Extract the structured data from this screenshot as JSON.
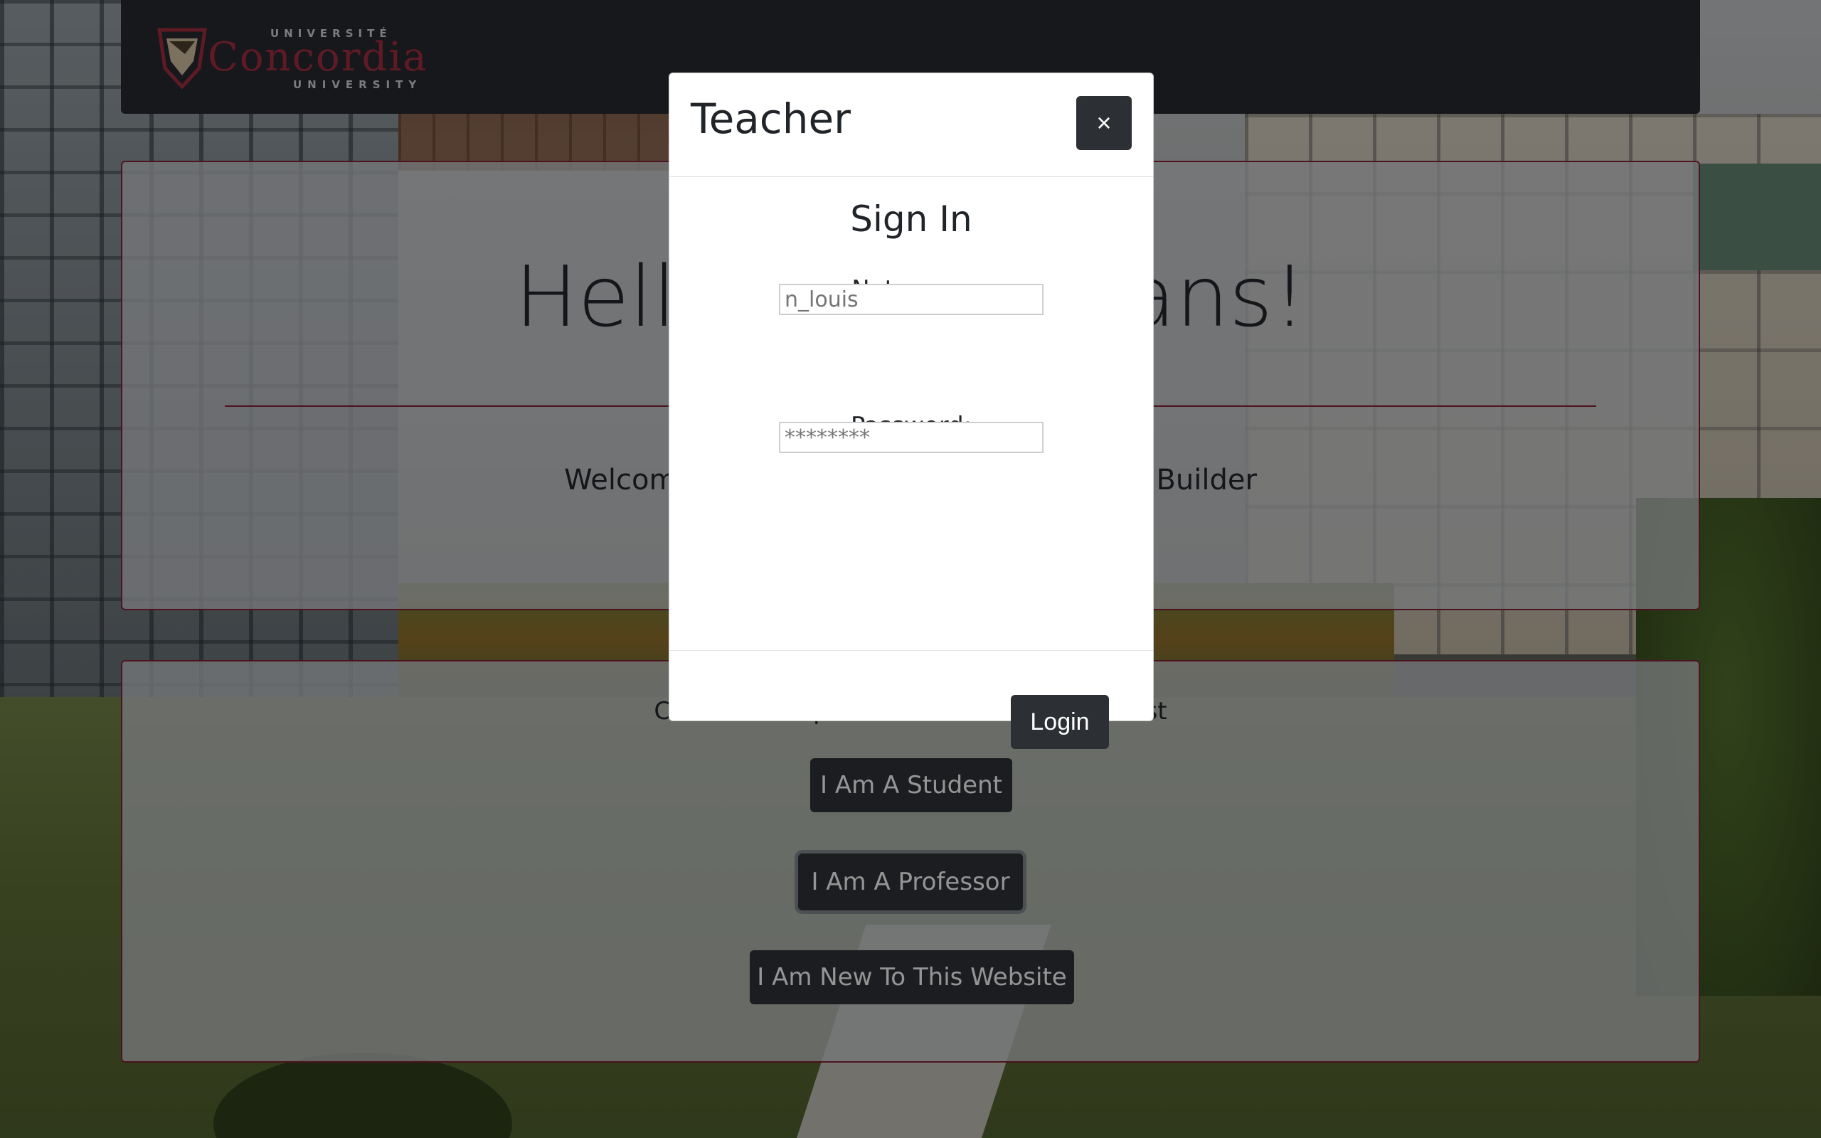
{
  "navbar": {
    "logo": {
      "top_text": "UNIVERSITÉ",
      "word": "Concordia",
      "bottom_text": "UNIVERSITY"
    }
  },
  "hero": {
    "title": "Hello Concordians!",
    "lead": "Welcome to Concordia's Online Schedule Builder"
  },
  "choice": {
    "prompt": "Choose the option that describes you best",
    "buttons": {
      "student": "I Am A Student",
      "professor": "I Am A Professor",
      "new": "I Am New To This Website"
    }
  },
  "modal": {
    "title": "Teacher",
    "close_label": "×",
    "heading": "Sign In",
    "netname_label": "Netname:",
    "netname_placeholder": "n_louis",
    "password_label": "Password:",
    "password_placeholder": "********",
    "login_label": "Login"
  },
  "colors": {
    "brand": "#7c1f33",
    "navbar": "#24272c",
    "button": "#2c3035"
  }
}
